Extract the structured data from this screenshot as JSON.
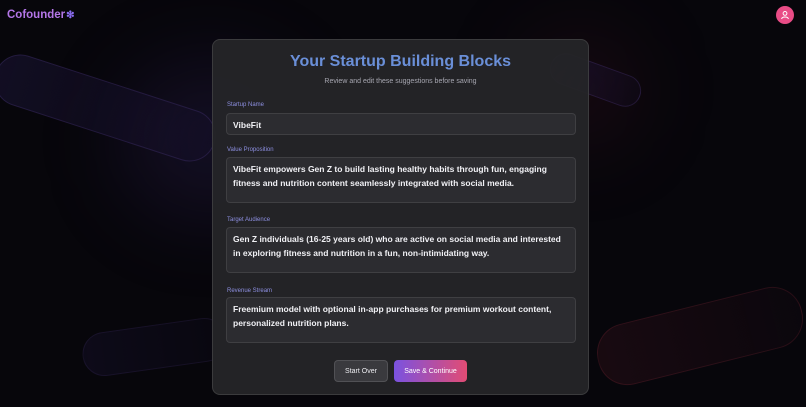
{
  "app": {
    "logo_text": "Cofounder",
    "logo_icon": "sparkle-icon",
    "avatar_icon": "user-icon",
    "accent_color": "#b476e8",
    "avatar_color": "#e94c86"
  },
  "card": {
    "title": "Your Startup Building Blocks",
    "subtitle": "Review and edit these suggestions before saving",
    "fields": {
      "startup_name": {
        "label": "Startup Name",
        "value": "VibeFit"
      },
      "value_proposition": {
        "label": "Value Proposition",
        "value": "VibeFit empowers Gen Z to build lasting healthy habits through fun, engaging fitness and nutrition content seamlessly integrated with social media."
      },
      "target_audience": {
        "label": "Target Audience",
        "value": "Gen Z individuals (16-25 years old) who are active on social media and interested in exploring fitness and nutrition in a fun, non-intimidating way."
      },
      "revenue_stream": {
        "label": "Revenue Stream",
        "value": "Freemium model with optional in-app purchases for premium workout content, personalized nutrition plans."
      }
    },
    "buttons": {
      "start_over": "Start Over",
      "save_continue": "Save & Continue"
    },
    "colors": {
      "title": "#6a8fd8",
      "label": "#8d8fe0",
      "primary_gradient_start": "#7a52e0",
      "primary_gradient_end": "#e24c74"
    }
  }
}
